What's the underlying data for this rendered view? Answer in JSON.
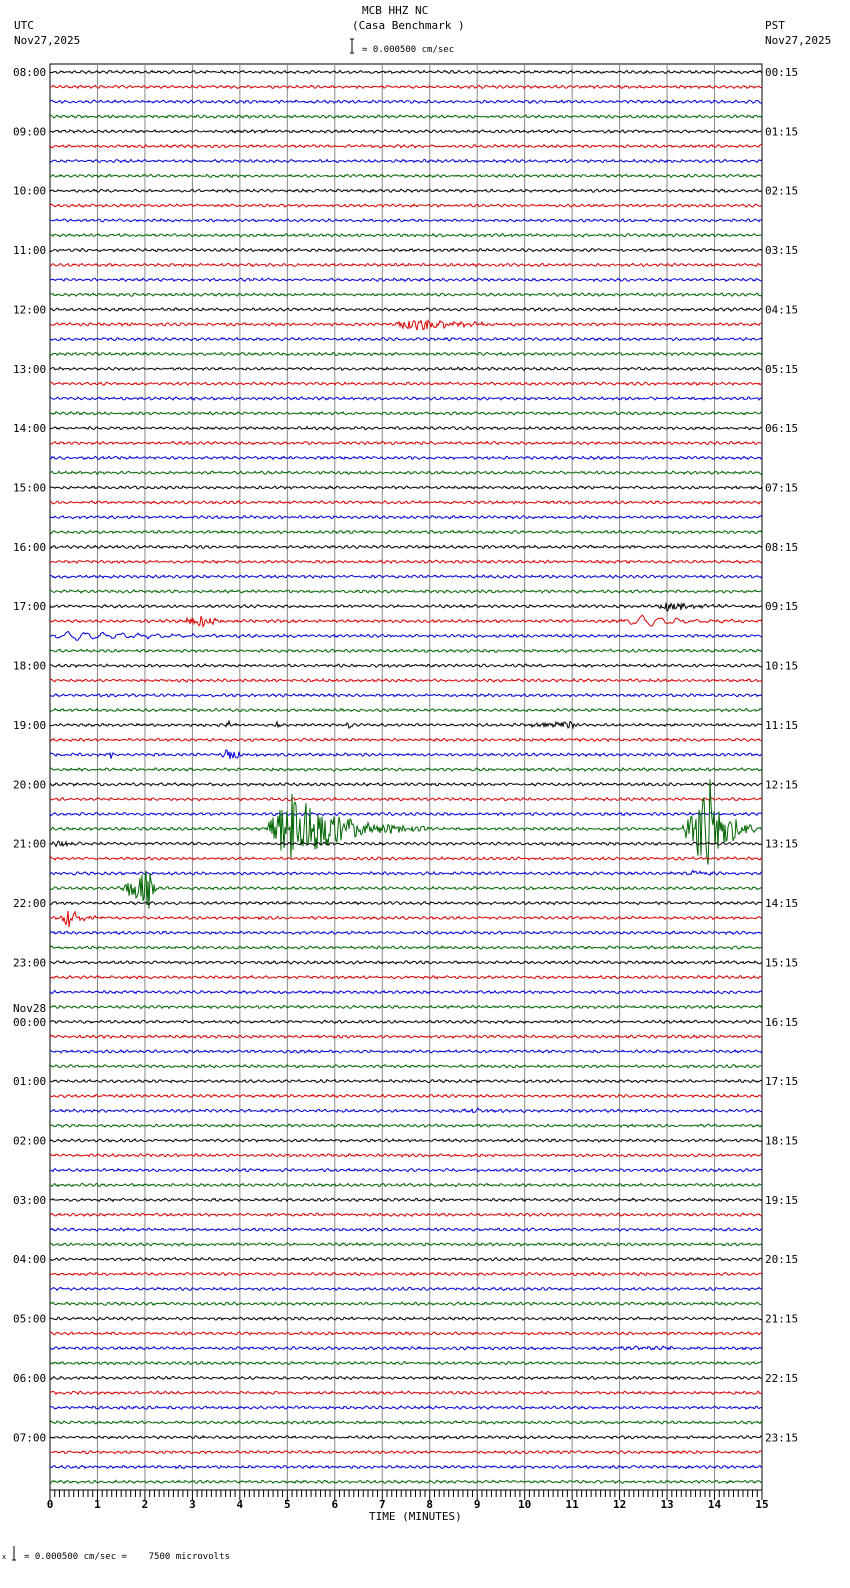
{
  "header": {
    "station": "MCB HHZ NC",
    "site": "(Casa Benchmark )",
    "left_tz": "UTC",
    "left_date": "Nov27,2025",
    "right_tz": "PST",
    "right_date": "Nov27,2025",
    "scale": "= 0.000500 cm/sec"
  },
  "footer": {
    "scale": "= 0.000500 cm/sec =    7500 microvolts"
  },
  "chart_data": {
    "type": "line",
    "title": "MCB HHZ NC (Casa Benchmark )",
    "xlabel": "TIME (MINUTES)",
    "xlim": [
      0,
      15
    ],
    "x_ticks": [
      "0",
      "1",
      "2",
      "3",
      "4",
      "5",
      "6",
      "7",
      "8",
      "9",
      "10",
      "11",
      "12",
      "13",
      "14",
      "15"
    ],
    "grid": true,
    "trace_colors": [
      "#000000",
      "#dd0000",
      "#0000dd",
      "#006600"
    ],
    "traces_per_hour": 4,
    "left_labels": [
      {
        "row": 0,
        "text": "08:00"
      },
      {
        "row": 4,
        "text": "09:00"
      },
      {
        "row": 8,
        "text": "10:00"
      },
      {
        "row": 12,
        "text": "11:00"
      },
      {
        "row": 16,
        "text": "12:00"
      },
      {
        "row": 20,
        "text": "13:00"
      },
      {
        "row": 24,
        "text": "14:00"
      },
      {
        "row": 28,
        "text": "15:00"
      },
      {
        "row": 32,
        "text": "16:00"
      },
      {
        "row": 36,
        "text": "17:00"
      },
      {
        "row": 40,
        "text": "18:00"
      },
      {
        "row": 44,
        "text": "19:00"
      },
      {
        "row": 48,
        "text": "20:00"
      },
      {
        "row": 52,
        "text": "21:00"
      },
      {
        "row": 56,
        "text": "22:00"
      },
      {
        "row": 60,
        "text": "23:00"
      },
      {
        "row": 64,
        "text": "00:00",
        "date": "Nov28"
      },
      {
        "row": 68,
        "text": "01:00"
      },
      {
        "row": 72,
        "text": "02:00"
      },
      {
        "row": 76,
        "text": "03:00"
      },
      {
        "row": 80,
        "text": "04:00"
      },
      {
        "row": 84,
        "text": "05:00"
      },
      {
        "row": 88,
        "text": "06:00"
      },
      {
        "row": 92,
        "text": "07:00"
      }
    ],
    "right_labels": [
      "00:15",
      "01:15",
      "02:15",
      "03:15",
      "04:15",
      "05:15",
      "06:15",
      "07:15",
      "08:15",
      "09:15",
      "10:15",
      "11:15",
      "12:15",
      "13:15",
      "14:15",
      "15:15",
      "16:15",
      "17:15",
      "18:15",
      "19:15",
      "20:15",
      "21:15",
      "22:15",
      "23:15"
    ],
    "num_traces": 96,
    "events": [
      {
        "row": 17,
        "start": 7.0,
        "end": 10.2,
        "peak": 7.8,
        "amp": 6
      },
      {
        "row": 36,
        "start": 12.7,
        "end": 15.0,
        "peak": 13.0,
        "amp": 4
      },
      {
        "row": 37,
        "start": 2.7,
        "end": 4.2,
        "peak": 3.2,
        "amp": 6
      },
      {
        "row": 37,
        "start": 12.0,
        "end": 15.0,
        "peak": 12.5,
        "amp": 5,
        "long_period": true
      },
      {
        "row": 38,
        "start": 0.0,
        "end": 5.2,
        "peak": 0.5,
        "amp": 4,
        "long_period": true
      },
      {
        "row": 44,
        "start": 3.7,
        "end": 3.9,
        "peak": 3.75,
        "amp": 8
      },
      {
        "row": 44,
        "start": 4.7,
        "end": 4.9,
        "peak": 4.8,
        "amp": 4
      },
      {
        "row": 44,
        "start": 6.2,
        "end": 6.5,
        "peak": 6.3,
        "amp": 4
      },
      {
        "row": 44,
        "start": 10.0,
        "end": 11.2,
        "peak": 11.0,
        "amp": 4
      },
      {
        "row": 46,
        "start": 1.2,
        "end": 1.4,
        "peak": 1.3,
        "amp": 5
      },
      {
        "row": 46,
        "start": 3.6,
        "end": 4.5,
        "peak": 3.7,
        "amp": 8
      },
      {
        "row": 51,
        "start": 4.5,
        "end": 8.0,
        "peak": 5.1,
        "amp": 40
      },
      {
        "row": 51,
        "start": 13.3,
        "end": 15.0,
        "peak": 13.9,
        "amp": 50
      },
      {
        "row": 52,
        "start": 0.0,
        "end": 1.0,
        "peak": 0.2,
        "amp": 4
      },
      {
        "row": 54,
        "start": 13.3,
        "end": 14.2,
        "peak": 13.6,
        "amp": 3
      },
      {
        "row": 55,
        "start": 1.4,
        "end": 2.3,
        "peak": 2.1,
        "amp": 20
      },
      {
        "row": 57,
        "start": 0.2,
        "end": 1.1,
        "peak": 0.4,
        "amp": 10
      },
      {
        "row": 70,
        "start": 8.0,
        "end": 10.0,
        "peak": 9.0,
        "amp": 2
      },
      {
        "row": 86,
        "start": 11.5,
        "end": 15.0,
        "peak": 12.5,
        "amp": 2
      }
    ]
  }
}
